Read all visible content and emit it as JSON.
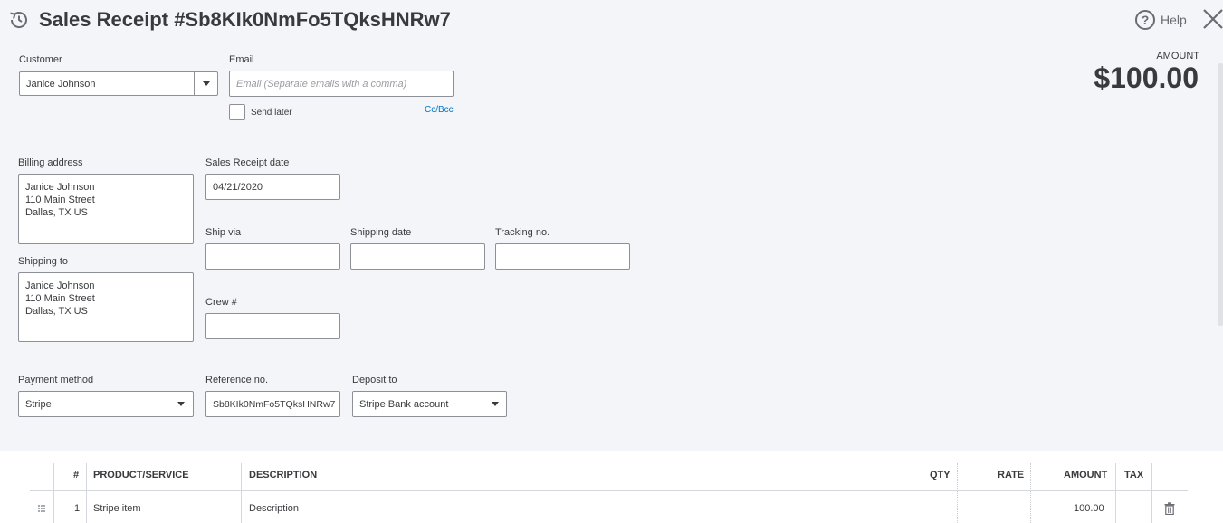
{
  "header": {
    "title": "Sales Receipt #Sb8KIk0NmFo5TQksHNRw7",
    "help_label": "Help"
  },
  "customer": {
    "label": "Customer",
    "value": "Janice Johnson"
  },
  "email": {
    "label": "Email",
    "placeholder": "Email (Separate emails with a comma)",
    "send_later_label": "Send later",
    "cc_bcc_label": "Cc/Bcc"
  },
  "amount": {
    "label": "AMOUNT",
    "value": "$100.00"
  },
  "billing": {
    "label": "Billing address",
    "value": "Janice Johnson\n110 Main Street\nDallas, TX US"
  },
  "shipping_to": {
    "label": "Shipping to",
    "value": "Janice Johnson\n110 Main Street\nDallas, TX US"
  },
  "receipt_date": {
    "label": "Sales Receipt date",
    "value": "04/21/2020"
  },
  "ship_via": {
    "label": "Ship via",
    "value": ""
  },
  "shipping_date": {
    "label": "Shipping date",
    "value": ""
  },
  "tracking": {
    "label": "Tracking no.",
    "value": ""
  },
  "crew": {
    "label": "Crew #",
    "value": ""
  },
  "payment_method": {
    "label": "Payment method",
    "value": "Stripe"
  },
  "reference": {
    "label": "Reference no.",
    "value": "Sb8KIk0NmFo5TQksHNRw7"
  },
  "deposit_to": {
    "label": "Deposit to",
    "value": "Stripe Bank account"
  },
  "table": {
    "headers": {
      "num": "#",
      "product": "PRODUCT/SERVICE",
      "description": "DESCRIPTION",
      "qty": "QTY",
      "rate": "RATE",
      "amount": "AMOUNT",
      "tax": "TAX"
    },
    "rows": [
      {
        "num": "1",
        "product": "Stripe item",
        "description": "Description",
        "qty": "",
        "rate": "",
        "amount": "100.00"
      }
    ]
  },
  "icons": {
    "history": "history-icon",
    "help": "help-icon",
    "close": "close-icon",
    "drag": "drag-handle-icon",
    "delete": "trash-icon"
  }
}
